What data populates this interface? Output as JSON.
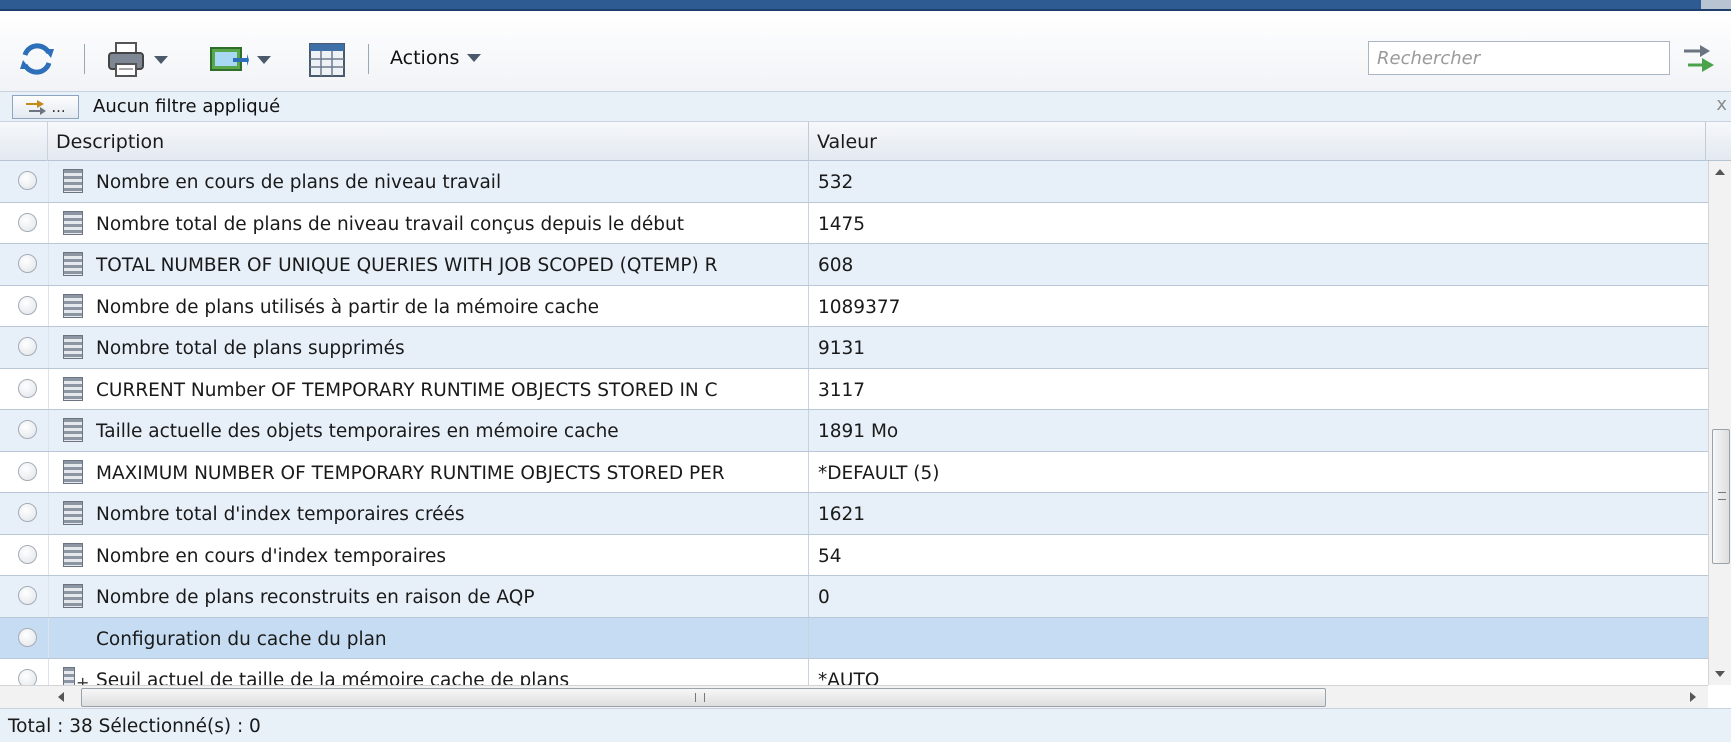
{
  "toolbar": {
    "refresh_icon": "refresh-icon",
    "print_icon": "printer-icon",
    "export_icon": "export-icon",
    "columns_icon": "table-columns-icon",
    "actions_label": "Actions",
    "search_placeholder": "Rechercher",
    "search_go_icon": "search-go-icon"
  },
  "filter": {
    "button_label": "...",
    "status_text": "Aucun filtre appliqué",
    "close_label": "x"
  },
  "columns": {
    "description": "Description",
    "value": "Valeur"
  },
  "rows": [
    {
      "description": "Nombre en cours de plans de niveau travail",
      "value": "532"
    },
    {
      "description": "Nombre total de plans de niveau travail conçus depuis le début",
      "value": "1475"
    },
    {
      "description": "TOTAL NUMBER OF UNIQUE QUERIES WITH JOB SCOPED (QTEMP) R",
      "value": "608"
    },
    {
      "description": "Nombre de plans utilisés à partir de la mémoire cache",
      "value": "1089377"
    },
    {
      "description": "Nombre total de plans supprimés",
      "value": "9131"
    },
    {
      "description": "CURRENT Number OF TEMPORARY RUNTIME OBJECTS STORED IN C",
      "value": "3117"
    },
    {
      "description": "Taille actuelle des objets temporaires en mémoire cache",
      "value": "1891 Mo"
    },
    {
      "description": "MAXIMUM NUMBER OF TEMPORARY RUNTIME OBJECTS STORED PER",
      "value": "*DEFAULT (5)"
    },
    {
      "description": "Nombre total d'index temporaires créés",
      "value": "1621"
    },
    {
      "description": "Nombre en cours d'index temporaires",
      "value": "54"
    },
    {
      "description": "Nombre de plans reconstruits en raison de AQP",
      "value": "0"
    }
  ],
  "group_row": {
    "description": "Configuration du cache du plan",
    "value": ""
  },
  "partial_row": {
    "description": "Seuil actuel de taille de la mémoire cache de plans",
    "value": "*AUTO"
  },
  "status": {
    "text": "Total : 38 Sélectionné(s) : 0"
  },
  "colors": {
    "title_bar": "#2f5b93",
    "row_alt": "#e7eff8",
    "group_row": "#c6dcf2",
    "filter_bar": "#e8f0f8"
  }
}
